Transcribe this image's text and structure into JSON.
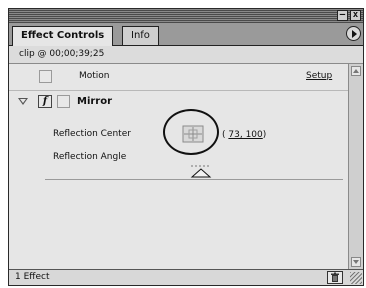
{
  "window": {
    "minimize_label": "–",
    "close_label": "x"
  },
  "tabs": [
    {
      "label": "Effect Controls",
      "active": true
    },
    {
      "label": "Info",
      "active": false
    }
  ],
  "clip_info": "clip @ 00;00;39;25",
  "effects": {
    "motion": {
      "label": "Motion",
      "setup_label": "Setup"
    },
    "mirror": {
      "label": "Mirror",
      "fx_symbol": "f",
      "reflection_center": {
        "label": "Reflection Center",
        "value": "73, 100",
        "open": "(",
        "close": ")"
      },
      "reflection_angle": {
        "label": "Reflection Angle"
      }
    }
  },
  "footer": {
    "count_label": "1 Effect"
  },
  "icons": {
    "panel_menu": "panel-menu-arrow-icon",
    "twirl": "twirl-down-triangle-icon",
    "crosshair": "crosshair-target-icon",
    "angle": "angle-triangle-icon",
    "trash": "trash-icon",
    "grip": "resize-grip-icon"
  }
}
